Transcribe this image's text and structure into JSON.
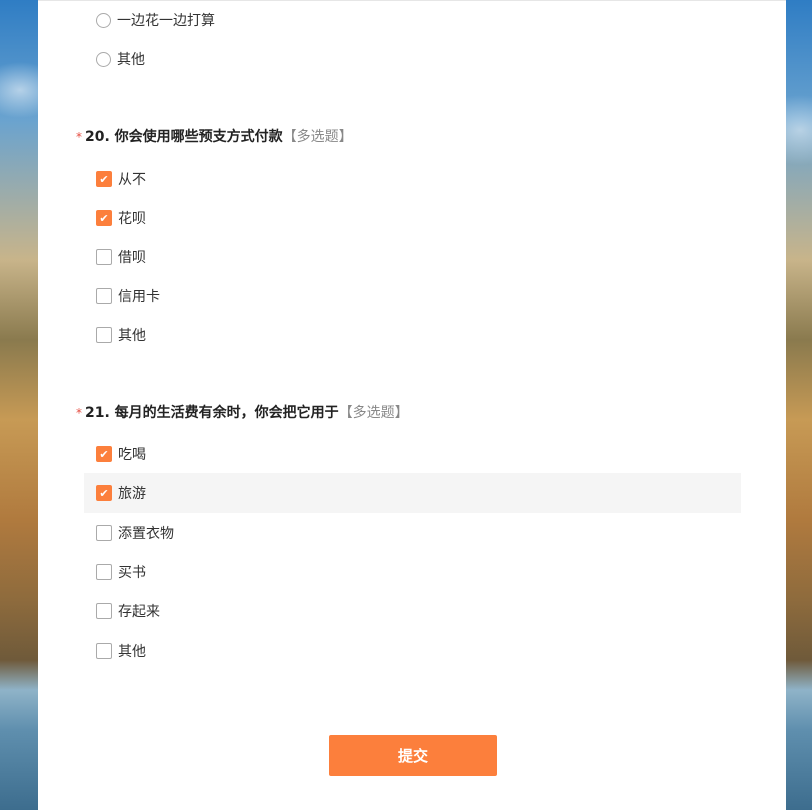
{
  "q19_tail": {
    "options": [
      "一边花一边打算",
      "其他"
    ]
  },
  "q20": {
    "required_mark": "*",
    "title": "20. 你会使用哪些预支方式付款",
    "tag": "【多选题】",
    "options": [
      {
        "label": "从不",
        "checked": true
      },
      {
        "label": "花呗",
        "checked": true
      },
      {
        "label": "借呗",
        "checked": false
      },
      {
        "label": "信用卡",
        "checked": false
      },
      {
        "label": "其他",
        "checked": false
      }
    ]
  },
  "q21": {
    "required_mark": "*",
    "title": "21. 每月的生活费有余时，你会把它用于",
    "tag": "【多选题】",
    "options": [
      {
        "label": "吃喝",
        "checked": true
      },
      {
        "label": "旅游",
        "checked": true
      },
      {
        "label": "添置衣物",
        "checked": false
      },
      {
        "label": "买书",
        "checked": false
      },
      {
        "label": "存起来",
        "checked": false
      },
      {
        "label": "其他",
        "checked": false
      }
    ]
  },
  "submit_label": "提交",
  "colors": {
    "accent": "#fc7f3c",
    "required": "#e54d42"
  }
}
